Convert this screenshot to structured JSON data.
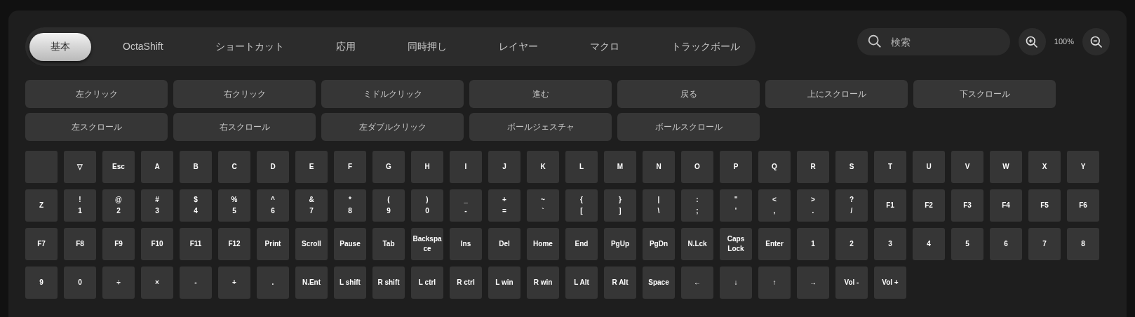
{
  "tabs": [
    {
      "label": "基本",
      "selected": true
    },
    {
      "label": "OctaShift",
      "selected": false
    },
    {
      "label": "ショートカット",
      "selected": false
    },
    {
      "label": "応用",
      "selected": false
    },
    {
      "label": "同時押し",
      "selected": false
    },
    {
      "label": "レイヤー",
      "selected": false
    },
    {
      "label": "マクロ",
      "selected": false
    },
    {
      "label": "トラックボール",
      "selected": false
    }
  ],
  "search": {
    "placeholder": "検索"
  },
  "zoom": {
    "reading": "100%"
  },
  "mouse_buttons": [
    "左クリック",
    "右クリック",
    "ミドルクリック",
    "進む",
    "戻る",
    "上にスクロール",
    "下スクロール",
    "左スクロール",
    "右スクロール",
    "左ダブルクリック",
    "ボールジェスチャ",
    "ボールスクロール"
  ],
  "keys": [
    {
      "kind": "blank"
    },
    {
      "kind": "char",
      "label": "▽"
    },
    {
      "kind": "char",
      "label": "Esc"
    },
    {
      "kind": "char",
      "label": "A"
    },
    {
      "kind": "char",
      "label": "B"
    },
    {
      "kind": "char",
      "label": "C"
    },
    {
      "kind": "char",
      "label": "D"
    },
    {
      "kind": "char",
      "label": "E"
    },
    {
      "kind": "char",
      "label": "F"
    },
    {
      "kind": "char",
      "label": "G"
    },
    {
      "kind": "char",
      "label": "H"
    },
    {
      "kind": "char",
      "label": "I"
    },
    {
      "kind": "char",
      "label": "J"
    },
    {
      "kind": "char",
      "label": "K"
    },
    {
      "kind": "char",
      "label": "L"
    },
    {
      "kind": "char",
      "label": "M"
    },
    {
      "kind": "char",
      "label": "N"
    },
    {
      "kind": "char",
      "label": "O"
    },
    {
      "kind": "char",
      "label": "P"
    },
    {
      "kind": "char",
      "label": "Q"
    },
    {
      "kind": "char",
      "label": "R"
    },
    {
      "kind": "char",
      "label": "S"
    },
    {
      "kind": "char",
      "label": "T"
    },
    {
      "kind": "char",
      "label": "U"
    },
    {
      "kind": "char",
      "label": "V"
    },
    {
      "kind": "char",
      "label": "W"
    },
    {
      "kind": "char",
      "label": "X"
    },
    {
      "kind": "char",
      "label": "Y"
    },
    {
      "kind": "char",
      "label": "Z"
    },
    {
      "kind": "pair",
      "upper": "!",
      "lower": "1"
    },
    {
      "kind": "pair",
      "upper": "@",
      "lower": "2"
    },
    {
      "kind": "pair",
      "upper": "#",
      "lower": "3"
    },
    {
      "kind": "pair",
      "upper": "$",
      "lower": "4"
    },
    {
      "kind": "pair",
      "upper": "%",
      "lower": "5"
    },
    {
      "kind": "pair",
      "upper": "^",
      "lower": "6"
    },
    {
      "kind": "pair",
      "upper": "&",
      "lower": "7"
    },
    {
      "kind": "pair",
      "upper": "*",
      "lower": "8"
    },
    {
      "kind": "pair",
      "upper": "(",
      "lower": "9"
    },
    {
      "kind": "pair",
      "upper": ")",
      "lower": "0"
    },
    {
      "kind": "pair",
      "upper": "_",
      "lower": "-"
    },
    {
      "kind": "pair",
      "upper": "+",
      "lower": "="
    },
    {
      "kind": "pair",
      "upper": "~",
      "lower": "`"
    },
    {
      "kind": "pair",
      "upper": "{",
      "lower": "["
    },
    {
      "kind": "pair",
      "upper": "}",
      "lower": "]"
    },
    {
      "kind": "pair",
      "upper": "|",
      "lower": "\\"
    },
    {
      "kind": "pair",
      "upper": ":",
      "lower": ";"
    },
    {
      "kind": "pair",
      "upper": "\"",
      "lower": "'"
    },
    {
      "kind": "pair",
      "upper": "<",
      "lower": ","
    },
    {
      "kind": "pair",
      "upper": ">",
      "lower": "."
    },
    {
      "kind": "pair",
      "upper": "?",
      "lower": "/"
    },
    {
      "kind": "char",
      "label": "F1"
    },
    {
      "kind": "char",
      "label": "F2"
    },
    {
      "kind": "char",
      "label": "F3"
    },
    {
      "kind": "char",
      "label": "F4"
    },
    {
      "kind": "char",
      "label": "F5"
    },
    {
      "kind": "char",
      "label": "F6"
    },
    {
      "kind": "char",
      "label": "F7"
    },
    {
      "kind": "char",
      "label": "F8"
    },
    {
      "kind": "char",
      "label": "F9"
    },
    {
      "kind": "char",
      "label": "F10"
    },
    {
      "kind": "char",
      "label": "F11"
    },
    {
      "kind": "char",
      "label": "F12"
    },
    {
      "kind": "char",
      "label": "Print"
    },
    {
      "kind": "char",
      "label": "Scroll"
    },
    {
      "kind": "char",
      "label": "Pause"
    },
    {
      "kind": "char",
      "label": "Tab"
    },
    {
      "kind": "char",
      "label": "Backspace"
    },
    {
      "kind": "char",
      "label": "Ins"
    },
    {
      "kind": "char",
      "label": "Del"
    },
    {
      "kind": "char",
      "label": "Home"
    },
    {
      "kind": "char",
      "label": "End"
    },
    {
      "kind": "char",
      "label": "PgUp"
    },
    {
      "kind": "char",
      "label": "PgDn"
    },
    {
      "kind": "char",
      "label": "N.Lck"
    },
    {
      "kind": "char",
      "label": "Caps Lock"
    },
    {
      "kind": "char",
      "label": "Enter"
    },
    {
      "kind": "char",
      "label": "1"
    },
    {
      "kind": "char",
      "label": "2"
    },
    {
      "kind": "char",
      "label": "3"
    },
    {
      "kind": "char",
      "label": "4"
    },
    {
      "kind": "char",
      "label": "5"
    },
    {
      "kind": "char",
      "label": "6"
    },
    {
      "kind": "char",
      "label": "7"
    },
    {
      "kind": "char",
      "label": "8"
    },
    {
      "kind": "char",
      "label": "9"
    },
    {
      "kind": "char",
      "label": "0"
    },
    {
      "kind": "char",
      "label": "÷"
    },
    {
      "kind": "char",
      "label": "×"
    },
    {
      "kind": "char",
      "label": "-"
    },
    {
      "kind": "char",
      "label": "+"
    },
    {
      "kind": "char",
      "label": "."
    },
    {
      "kind": "char",
      "label": "N.Ent"
    },
    {
      "kind": "char",
      "label": "L shift"
    },
    {
      "kind": "char",
      "label": "R shift"
    },
    {
      "kind": "char",
      "label": "L ctrl"
    },
    {
      "kind": "char",
      "label": "R ctrl"
    },
    {
      "kind": "char",
      "label": "L win"
    },
    {
      "kind": "char",
      "label": "R win"
    },
    {
      "kind": "char",
      "label": "L Alt"
    },
    {
      "kind": "char",
      "label": "R Alt"
    },
    {
      "kind": "char",
      "label": "Space"
    },
    {
      "kind": "char",
      "label": "←"
    },
    {
      "kind": "char",
      "label": "↓"
    },
    {
      "kind": "char",
      "label": "↑"
    },
    {
      "kind": "char",
      "label": "→"
    },
    {
      "kind": "char",
      "label": "Vol -"
    },
    {
      "kind": "char",
      "label": "Vol +"
    }
  ]
}
